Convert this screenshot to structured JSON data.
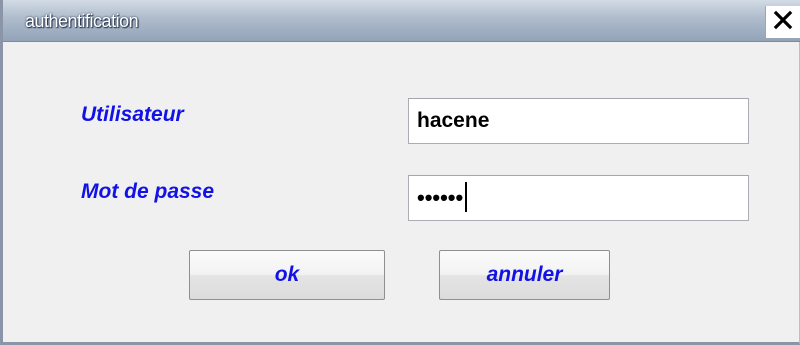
{
  "window": {
    "title": "authentification"
  },
  "form": {
    "username_label": "Utilisateur",
    "username_value": "hacene",
    "password_label": "Mot de passe",
    "password_value": "••••••"
  },
  "buttons": {
    "ok_label": "ok",
    "cancel_label": "annuler"
  },
  "icons": {
    "close": "close-icon"
  },
  "colors": {
    "label_text": "#1212e6",
    "title_text": "#ffffff",
    "titlebar": "#aebbcc"
  }
}
